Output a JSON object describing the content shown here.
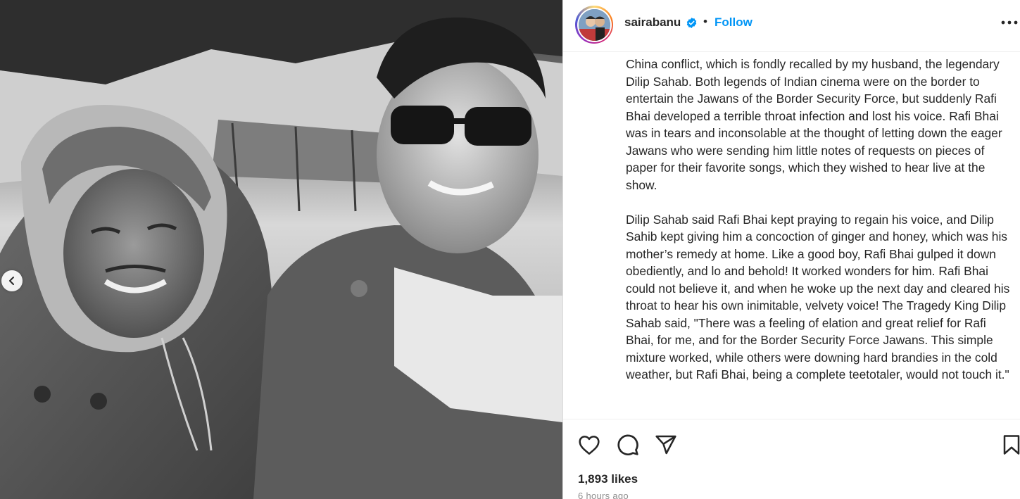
{
  "post": {
    "username": "sairabanu",
    "follow_label": "Follow",
    "separator": "•",
    "caption_paragraphs": [
      "China conflict, which is fondly recalled by my husband, the legendary Dilip Sahab. Both legends of Indian cinema were on the border to entertain the Jawans of the Border Security Force, but suddenly Rafi Bhai developed a terrible throat infection and lost his voice. Rafi Bhai was in tears and inconsolable at the thought of letting down the eager Jawans who were sending him little notes of requests on pieces of paper for their favorite songs, which they wished to hear live at the show.",
      "Dilip Sahab said Rafi Bhai kept praying to regain his voice, and Dilip Sahib kept giving him a concoction of ginger and honey, which was his mother’s remedy at home. Like a good boy, Rafi Bhai gulped it down obediently, and lo and behold! It worked wonders for him. Rafi Bhai could not believe it, and when he woke up the next day and cleared his throat to hear his own inimitable, velvety voice! The Tragedy King Dilip Sahab said, \"There was a feeling of elation and great relief for Rafi Bhai, for me, and for the Border Security Force Jawans. This simple mixture worked, while others were downing hard brandies in the cold weather, but Rafi Bhai, being a complete teetotaler, would not touch it.\""
    ],
    "likes_text": "1,893 likes",
    "timestamp": "6 hours ago"
  },
  "icons": {
    "verified": "verified-badge-icon",
    "more": "more-options-icon",
    "like": "heart-icon",
    "comment": "comment-icon",
    "share": "share-icon",
    "save": "bookmark-icon",
    "carousel_prev": "chevron-left-icon"
  },
  "colors": {
    "accent": "#0095f6",
    "text": "#262626",
    "muted": "#8e8e8e",
    "border": "#dbdbdb"
  }
}
